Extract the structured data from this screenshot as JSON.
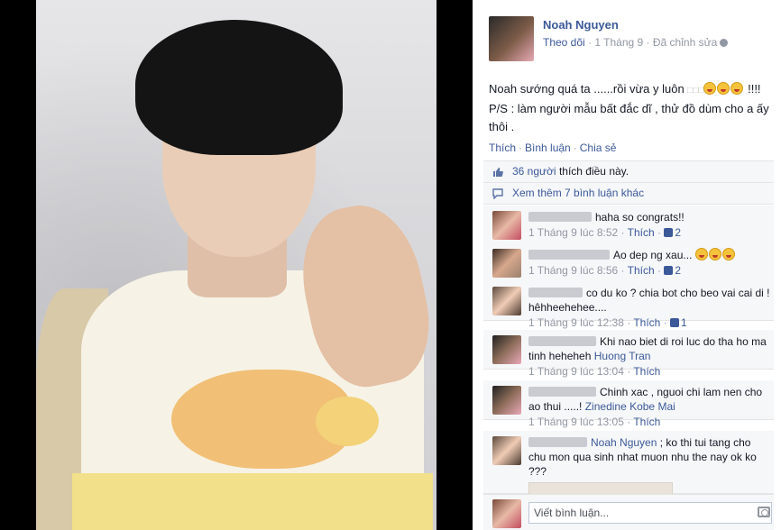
{
  "post": {
    "author": "Noah Nguyen",
    "follow_label": "Theo dõi",
    "sep1": " · ",
    "date": "1 Tháng 9",
    "sep2": " · ",
    "edited": "Đã chỉnh sửa",
    "text_line1": "Noah sướng quá ta ......rồi vừa y luôn",
    "text_line1_tail": "!!!!",
    "text_line2": "P/S : làm người mẫu bất đắc dĩ , thử đồ dùm cho a ấy thôi ."
  },
  "actions": {
    "like": "Thích",
    "comment": "Bình luận",
    "share": "Chia sẻ",
    "dot": "·"
  },
  "likes": {
    "count_label": "36 người",
    "suffix": " thích điều này."
  },
  "more_comments": "Xem thêm 7 bình luận khác",
  "comments": [
    {
      "text": "haha so congrats!!",
      "time": "1 Tháng 9 lúc 8:52",
      "like": "Thích",
      "likes": "2"
    },
    {
      "text": "Ao dep ng xau...",
      "time": "1 Tháng 9 lúc 8:56",
      "like": "Thích",
      "likes": "2"
    },
    {
      "text": "co du ko ? chia bot cho beo vai cai di ! hêhheehehee....",
      "time": "1 Tháng 9 lúc 12:38",
      "like": "Thích",
      "likes": "1"
    },
    {
      "text": "Khi nao biet di roi luc do tha ho ma tinh heheheh",
      "tag": "Huong Tran",
      "time": "1 Tháng 9 lúc 13:04",
      "like": "Thích"
    },
    {
      "text": "Chinh xac , nguoi chi lam nen cho ao thui .....!",
      "tag": "Zinedine Kobe Mai",
      "time": "1 Tháng 9 lúc 13:05",
      "like": "Thích"
    },
    {
      "tag": "Noah Nguyen",
      "text": "; ko thi tui tang cho chu mon qua sinh nhat muon nhu the nay ok ko ???"
    }
  ],
  "composer": {
    "placeholder": "Viết bình luận..."
  }
}
